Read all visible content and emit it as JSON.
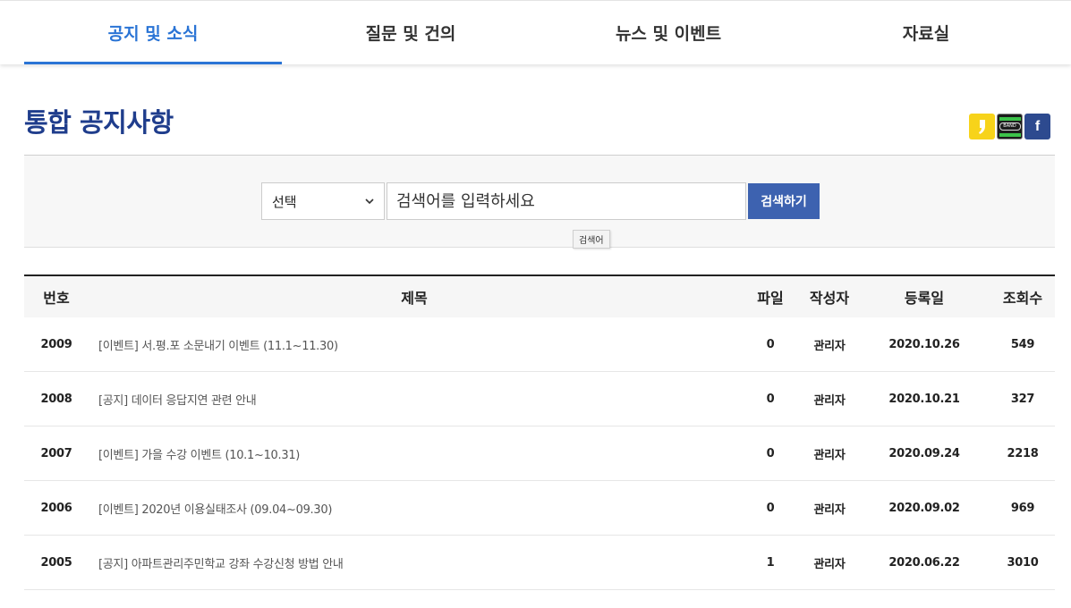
{
  "tabs": [
    {
      "label": "공지 및 소식",
      "active": true
    },
    {
      "label": "질문 및 건의",
      "active": false
    },
    {
      "label": "뉴스 및 이벤트",
      "active": false
    },
    {
      "label": "자료실",
      "active": false
    }
  ],
  "page_title": "통합 공지사항",
  "share": {
    "kakao_icon": "kakaostory-icon",
    "band_label": "BAND",
    "facebook_glyph": "f"
  },
  "search": {
    "select_value": "선택",
    "placeholder": "검색어를 입력하세요",
    "button_label": "검색하기",
    "tooltip": "검색어"
  },
  "table": {
    "headers": {
      "num": "번호",
      "title": "제목",
      "file": "파일",
      "author": "작성자",
      "date": "등록일",
      "views": "조회수"
    },
    "rows": [
      {
        "num": "2009",
        "title": "[이벤트] 서.평.포 소문내기 이벤트 (11.1~11.30)",
        "file": "0",
        "author": "관리자",
        "date": "2020.10.26",
        "views": "549"
      },
      {
        "num": "2008",
        "title": "[공지] 데이터 응답지연 관련 안내",
        "file": "0",
        "author": "관리자",
        "date": "2020.10.21",
        "views": "327"
      },
      {
        "num": "2007",
        "title": "[이벤트] 가을 수강 이벤트 (10.1~10.31)",
        "file": "0",
        "author": "관리자",
        "date": "2020.09.24",
        "views": "2218"
      },
      {
        "num": "2006",
        "title": "[이벤트] 2020년 이용실태조사 (09.04~09.30)",
        "file": "0",
        "author": "관리자",
        "date": "2020.09.02",
        "views": "969"
      },
      {
        "num": "2005",
        "title": "[공지] 아파트관리주민학교 강좌 수강신청 방법 안내",
        "file": "1",
        "author": "관리자",
        "date": "2020.06.22",
        "views": "3010"
      }
    ]
  },
  "colors": {
    "accent": "#2a74d5",
    "title": "#1f3d8c",
    "button": "#3d62b0"
  }
}
